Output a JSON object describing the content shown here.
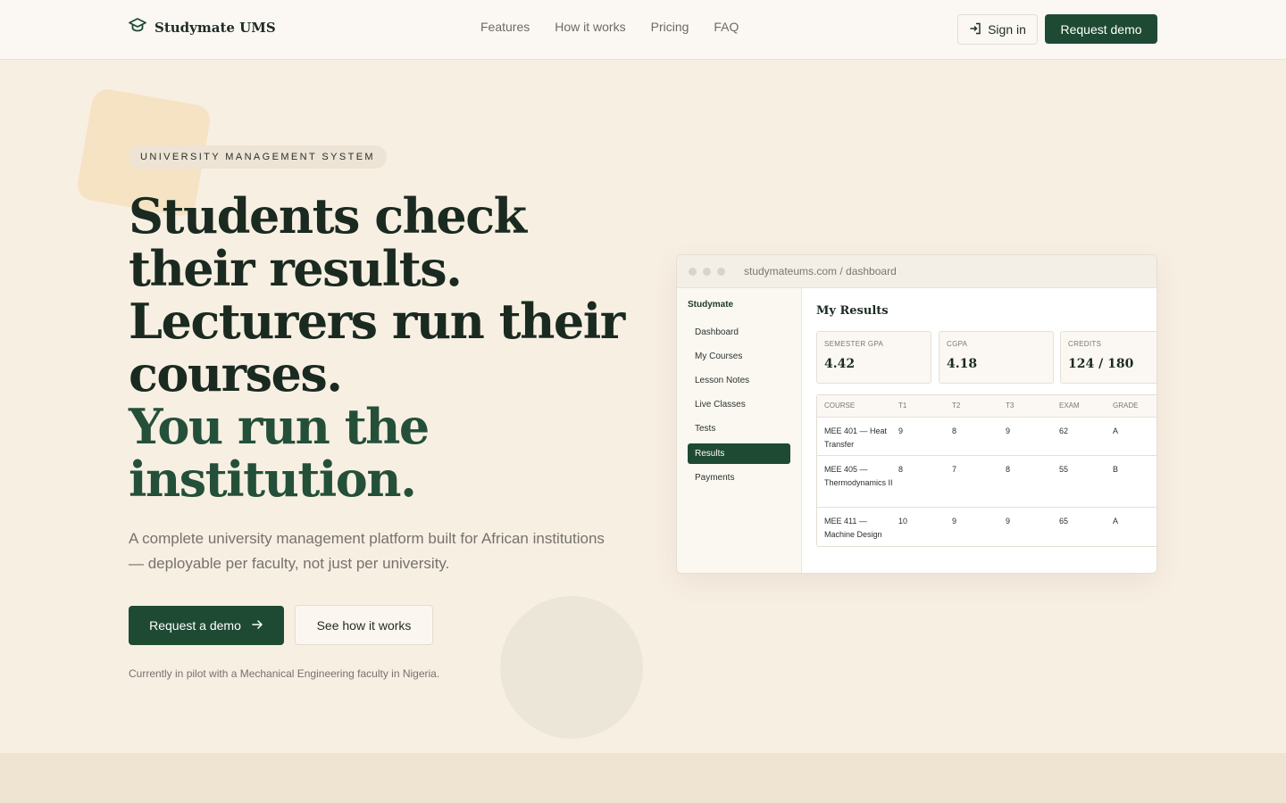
{
  "header": {
    "brand": "Studymate UMS",
    "nav": [
      "Features",
      "How it works",
      "Pricing",
      "FAQ"
    ],
    "sign_in": "Sign in",
    "request_demo": "Request demo"
  },
  "hero": {
    "eyebrow": "UNIVERSITY MANAGEMENT SYSTEM",
    "headline_1": "Students check their results.",
    "headline_2": "Lecturers run their courses.",
    "headline_3": "You run the institution.",
    "subhead": "A complete university management platform built for African institutions — deployable per faculty, not just per university.",
    "cta_primary": "Request a demo",
    "cta_secondary": "See how it works",
    "pilot_note": "Currently in pilot with a Mechanical Engineering faculty in Nigeria."
  },
  "mockup": {
    "url": "studymateums.com / dashboard",
    "sidebar_brand": "Studymate",
    "sidebar_items": [
      "Dashboard",
      "My Courses",
      "Lesson Notes",
      "Live Classes",
      "Tests",
      "Results",
      "Payments"
    ],
    "active_item": "Results",
    "title": "My Results",
    "stats": [
      {
        "label": "SEMESTER GPA",
        "value": "4.42"
      },
      {
        "label": "CGPA",
        "value": "4.18"
      },
      {
        "label": "CREDITS",
        "value": "124 / 180"
      }
    ],
    "table": {
      "headers": [
        "COURSE",
        "T1",
        "T2",
        "T3",
        "EXAM",
        "GRADE"
      ],
      "rows": [
        {
          "course": "MEE 401 — Heat Transfer",
          "t1": "9",
          "t2": "8",
          "t3": "9",
          "exam": "62",
          "grade": "A"
        },
        {
          "course": "MEE 405 — Thermodynamics II",
          "t1": "8",
          "t2": "7",
          "t3": "8",
          "exam": "55",
          "grade": "B"
        },
        {
          "course": "MEE 411 — Machine Design",
          "t1": "10",
          "t2": "9",
          "t3": "9",
          "exam": "65",
          "grade": "A"
        }
      ]
    }
  },
  "colors": {
    "accent": "#1e4a33",
    "background": "#f8efe3"
  }
}
